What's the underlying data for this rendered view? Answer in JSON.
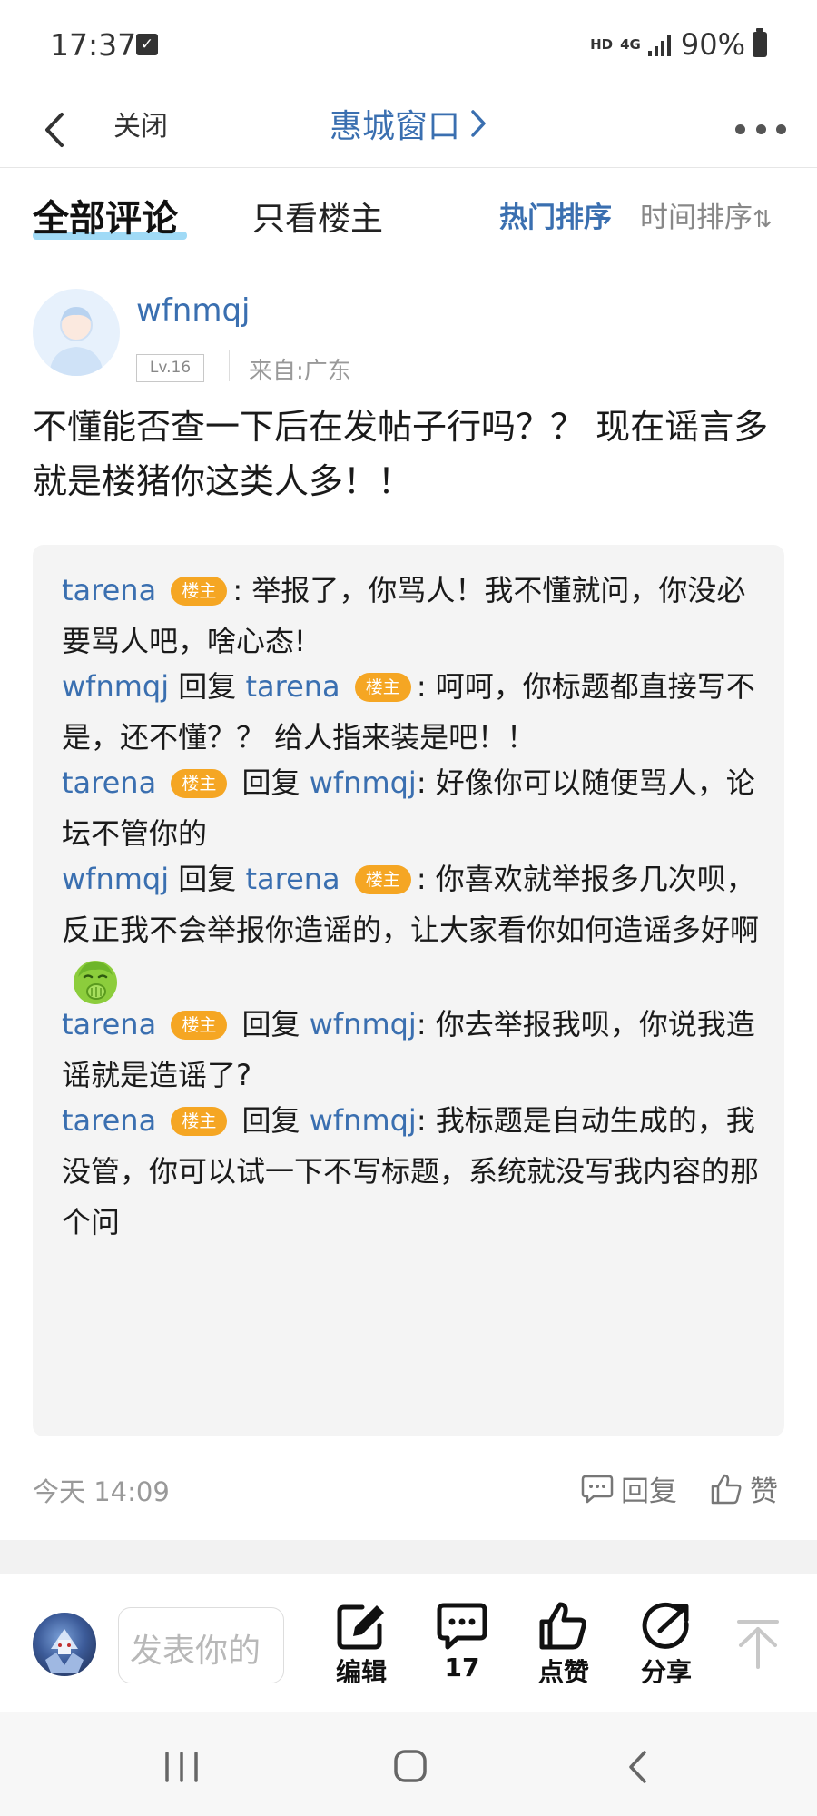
{
  "status_bar": {
    "time": "17:37",
    "hd": "HD",
    "network": "4G",
    "battery": "90%"
  },
  "nav": {
    "close_label": "关闭",
    "title": "惠城窗口"
  },
  "filter": {
    "tab_all": "全部评论",
    "tab_op_only": "只看楼主",
    "sort_hot": "热门排序",
    "sort_time": "时间排序"
  },
  "comment": {
    "username": "wfnmqj",
    "level": "Lv.16",
    "location": "来自:广东",
    "body": "不懂能否查一下后在发帖子行吗？？ 现在谣言多就是楼猪你这类人多！！",
    "time": "今天 14:09",
    "reply_label": "回复",
    "like_label": "赞"
  },
  "op_tag": "楼主",
  "reply_word": "回复",
  "replies": [
    {
      "author": "tarena",
      "is_op": true,
      "text": ": 举报了，你骂人！我不懂就问，你没必要骂人吧，啥心态!"
    },
    {
      "author": "wfnmqj",
      "target": "tarena",
      "target_is_op": true,
      "text": ": 呵呵，你标题都直接写不是，还不懂？？ 给人指来装是吧！！"
    },
    {
      "author": "tarena",
      "is_op": true,
      "target": "wfnmqj",
      "text": ": 好像你可以随便骂人，论坛不管你的"
    },
    {
      "author": "wfnmqj",
      "target": "tarena",
      "target_is_op": true,
      "text": ": 你喜欢就举报多几次呗，反正我不会举报你造谣的，让大家看你如何造谣多好啊",
      "emoji": "cover-mouth-laugh-emoji"
    },
    {
      "author": "tarena",
      "is_op": true,
      "target": "wfnmqj",
      "text": ": 你去举报我呗，你说我造谣就是造谣了?"
    },
    {
      "author": "tarena",
      "is_op": true,
      "target": "wfnmqj",
      "text": ": 我标题是自动生成的，我没管，你可以试一下不写标题，系统就没写我内容的那个问"
    }
  ],
  "toolbar": {
    "compose_placeholder": "发表你的",
    "edit_label": "编辑",
    "comment_count": "17",
    "like_label": "点赞",
    "share_label": "分享"
  },
  "colors": {
    "link_blue": "#3a6fb0",
    "op_tag_orange": "#f5a623",
    "tab_underline": "#8fd3f5"
  }
}
